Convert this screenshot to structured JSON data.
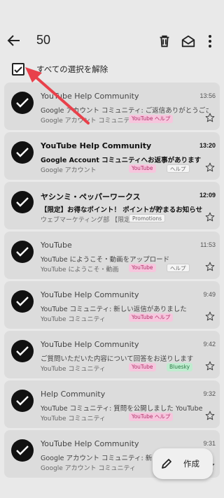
{
  "appbar": {
    "selected_count": "50",
    "deselect_all_label": "すべての選択を解除"
  },
  "icons": {
    "back": "arrow-left-icon",
    "delete": "trash-icon",
    "mark_unread": "envelope-open-icon",
    "more": "more-vert-icon",
    "checked": "check-icon",
    "star": "star-outline-icon",
    "compose": "pencil-icon"
  },
  "emails": [
    {
      "sender": "YouTube Help Community",
      "time": "13:56",
      "subject": "Google アカウント コミュニティ: ご返信ありがとうございます",
      "snippet": "Google アカウント コミュニティ",
      "unread": false,
      "tags": [
        {
          "label": "YouTube ヘルプ",
          "style": "pink"
        }
      ]
    },
    {
      "sender": "YouTube Help Community",
      "time": "13:20",
      "subject": "Google Account コミュニティへお返事があります",
      "snippet": "Google アカウント",
      "unread": true,
      "tags": [
        {
          "label": "YouTube",
          "style": "pink"
        },
        {
          "label": "ヘルプ",
          "style": "gray"
        }
      ]
    },
    {
      "sender": "ヤシンミ・ペッパーワークス",
      "time": "12:09",
      "subject": "【限定】お得なポイント！ ポイントが貯まるお知らせ",
      "snippet": "ウェブマーケティング部 【限定情報】",
      "unread": true,
      "tags": [
        {
          "label": "Promotions",
          "style": "gray"
        }
      ]
    },
    {
      "sender": "YouTube",
      "time": "11:53",
      "subject": "YouTube にようこそ・動画をアップロード",
      "snippet": "YouTube にようこそ・動画",
      "unread": false,
      "tags": [
        {
          "label": "YouTube",
          "style": "pink"
        },
        {
          "label": "ヘルプ",
          "style": "gray"
        }
      ]
    },
    {
      "sender": "YouTube Help Community",
      "time": "9:49",
      "subject": "YouTube コミュニティ: 新しい返信がありました",
      "snippet": "YouTube コミュニティ",
      "unread": false,
      "tags": [
        {
          "label": "YouTube ヘルプ",
          "style": "pink"
        }
      ]
    },
    {
      "sender": "YouTube Help Community",
      "time": "9:42",
      "subject": "ご質問いただいた内容について回答をお送りします",
      "snippet": "YouTube コミュニティ",
      "unread": false,
      "tags": [
        {
          "label": "YouTube",
          "style": "pink"
        },
        {
          "label": "Bluesky",
          "style": "green"
        }
      ]
    },
    {
      "sender": "Help Community",
      "time": "9:32",
      "subject": "YouTube コミュニティ: 質問を公開しました YouTube",
      "snippet": "YouTube コミュニティ",
      "unread": false,
      "tags": [
        {
          "label": "YouTube ヘルプ",
          "style": "pink"
        }
      ]
    },
    {
      "sender": "YouTube Help Community",
      "time": "9:31",
      "subject": "Google アカウント コミュニティ: 新しい回答",
      "snippet": "Google アカウント コミュニティ",
      "unread": false,
      "tags": []
    }
  ],
  "fab": {
    "label": "作成"
  },
  "colors": {
    "background": "#e9e9e9",
    "card": "#dcdcdc",
    "accent_arrow": "#e8414b"
  }
}
